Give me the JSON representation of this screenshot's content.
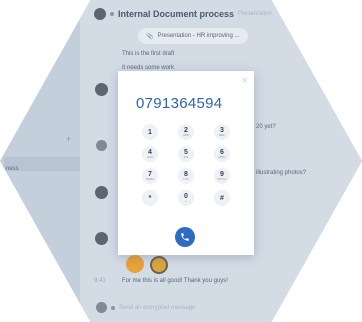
{
  "sidebar": {
    "item_label": "ness"
  },
  "chat": {
    "title": "Internal Document process",
    "subtitle": "Presentation",
    "pill_label": "Presentation - HR improving ...",
    "messages": [
      {
        "text": "This is the first draft"
      },
      {
        "text": "It needs some work"
      },
      {
        "text": "20 yet?"
      },
      {
        "text": "illustrating photos?"
      },
      {
        "text": "For me this is all good! Thank you guys!"
      }
    ],
    "reply_time": "9:41",
    "input_placeholder": "Send an encrypted message"
  },
  "dialer": {
    "number": "0791364594",
    "keys": [
      {
        "digit": "1",
        "letters": ""
      },
      {
        "digit": "2",
        "letters": "ABC"
      },
      {
        "digit": "3",
        "letters": "DEF"
      },
      {
        "digit": "4",
        "letters": "GHI"
      },
      {
        "digit": "5",
        "letters": "JKL"
      },
      {
        "digit": "6",
        "letters": "MNO"
      },
      {
        "digit": "7",
        "letters": "PQRS"
      },
      {
        "digit": "8",
        "letters": "TUV"
      },
      {
        "digit": "9",
        "letters": "WXYZ"
      },
      {
        "digit": "*",
        "letters": ""
      },
      {
        "digit": "0",
        "letters": "+"
      },
      {
        "digit": "#",
        "letters": ""
      }
    ],
    "call_icon": "phone-icon",
    "close_icon": "close-icon"
  },
  "colors": {
    "accent": "#2d6cc0",
    "number": "#2f64a8"
  }
}
